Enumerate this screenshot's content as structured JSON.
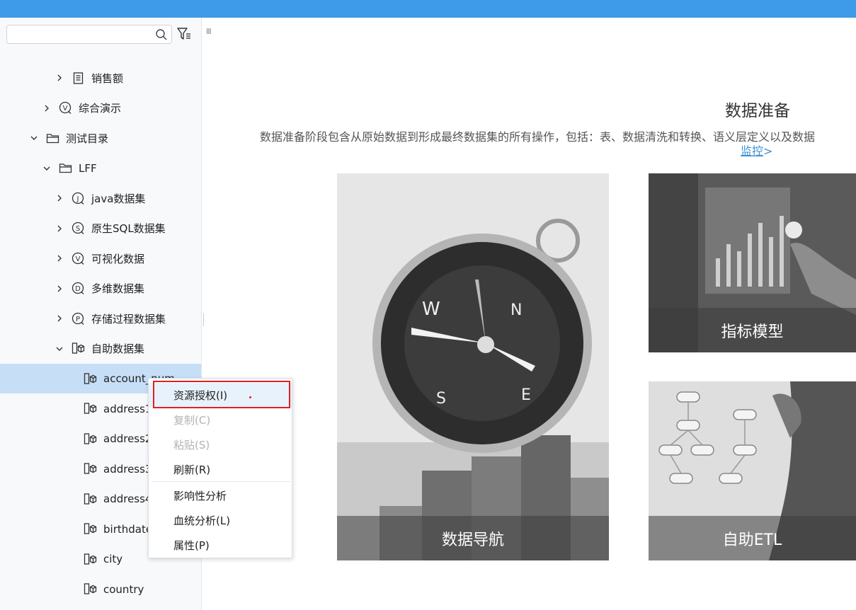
{
  "search": {
    "placeholder": "",
    "value": ""
  },
  "icons": {
    "search": "search-icon",
    "filter": "filter-icon",
    "report": "report-icon",
    "dataset_v": "visual-dataset-icon",
    "folder": "folder-icon",
    "dataset_j": "java-dataset-icon",
    "dataset_s": "sql-dataset-icon",
    "dataset_d": "multidim-dataset-icon",
    "dataset_p": "procedure-dataset-icon",
    "cube": "cube-icon",
    "chevron_right": "chevron-right-icon",
    "chevron_down": "chevron-down-icon"
  },
  "tree": [
    {
      "label": "销售额",
      "icon": "report",
      "level": 3,
      "chevron": "right"
    },
    {
      "label": "综合演示",
      "icon": "dataset_v",
      "level": 2,
      "chevron": "right"
    },
    {
      "label": "测试目录",
      "icon": "folder",
      "level": 1,
      "chevron": "down"
    },
    {
      "label": "LFF",
      "icon": "folder",
      "level": 2,
      "chevron": "down"
    },
    {
      "label": "java数据集",
      "icon": "dataset_j",
      "level": 3,
      "chevron": "right"
    },
    {
      "label": "原生SQL数据集",
      "icon": "dataset_s",
      "level": 3,
      "chevron": "right"
    },
    {
      "label": "可视化数据",
      "icon": "dataset_v",
      "level": 3,
      "chevron": "right"
    },
    {
      "label": "多维数据集",
      "icon": "dataset_d",
      "level": 3,
      "chevron": "right"
    },
    {
      "label": "存储过程数据集",
      "icon": "dataset_p",
      "level": 3,
      "chevron": "right"
    },
    {
      "label": "自助数据集",
      "icon": "cube",
      "level": 3,
      "chevron": "down"
    },
    {
      "label": "account_num",
      "icon": "cube",
      "level": 4,
      "chevron": "none",
      "selected": true
    },
    {
      "label": "address1",
      "icon": "cube",
      "level": 4,
      "chevron": "none"
    },
    {
      "label": "address2",
      "icon": "cube",
      "level": 4,
      "chevron": "none"
    },
    {
      "label": "address3",
      "icon": "cube",
      "level": 4,
      "chevron": "none"
    },
    {
      "label": "address4",
      "icon": "cube",
      "level": 4,
      "chevron": "none"
    },
    {
      "label": "birthdate",
      "icon": "cube",
      "level": 4,
      "chevron": "none"
    },
    {
      "label": "city",
      "icon": "cube",
      "level": 4,
      "chevron": "none"
    },
    {
      "label": "country",
      "icon": "cube",
      "level": 4,
      "chevron": "none"
    }
  ],
  "main": {
    "title": "数据准备",
    "description": "数据准备阶段包含从原始数据到形成最终数据集的所有操作，包括：表、数据清洗和转换、语义层定义以及数据",
    "link_text": "监控",
    "link_suffix": ">",
    "cards": [
      {
        "caption": "数据导航",
        "icon": "compass-image"
      },
      {
        "caption": "指标模型",
        "icon": "chart-screen-image"
      },
      {
        "caption": "自助ETL",
        "icon": "flow-whiteboard-image"
      }
    ]
  },
  "context_menu": {
    "items": [
      {
        "label": "资源授权(I)",
        "state": "active"
      },
      {
        "label": "复制(C)",
        "state": "disabled"
      },
      {
        "label": "粘贴(S)",
        "state": "disabled"
      },
      {
        "label": "刷新(R)",
        "state": "enabled"
      },
      {
        "label": "影响性分析",
        "state": "enabled"
      },
      {
        "label": "血统分析(L)",
        "state": "enabled"
      },
      {
        "label": "属性(P)",
        "state": "enabled"
      }
    ]
  },
  "colors": {
    "topbar": "#3d9be9",
    "selected_row": "#c7def7",
    "highlight": "#e02020",
    "link": "#3d8fd1"
  }
}
